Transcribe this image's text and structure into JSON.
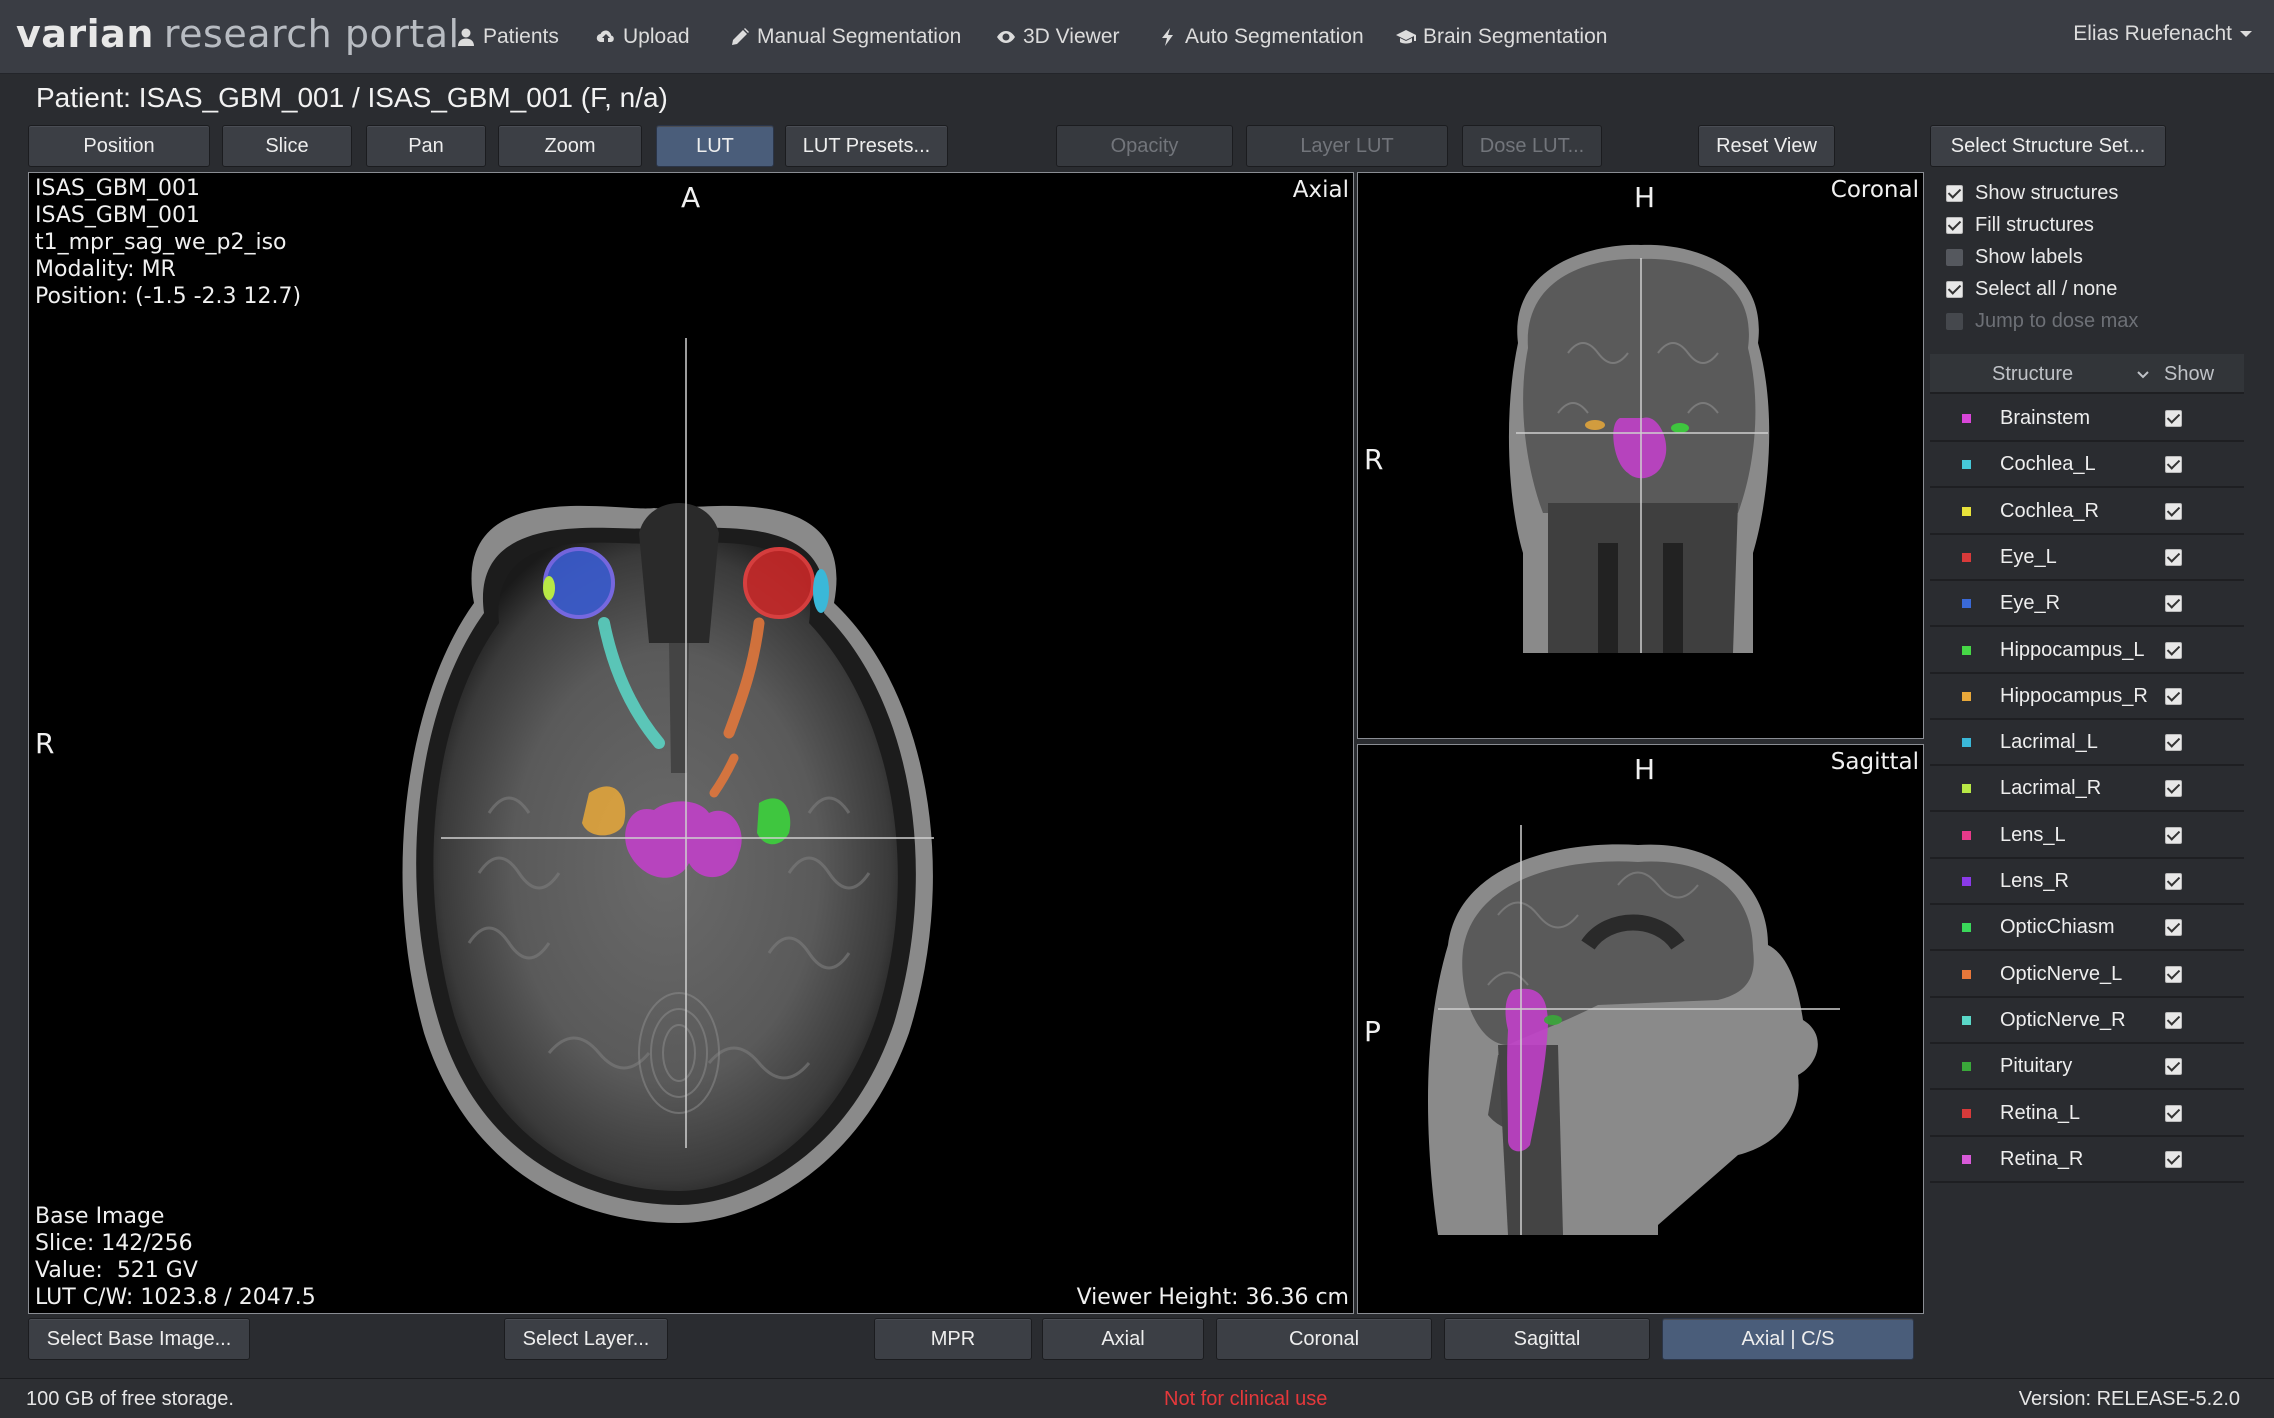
{
  "app": {
    "brand_part1": "varian",
    "brand_part2": "research portal"
  },
  "nav": {
    "patients": "Patients",
    "upload": "Upload",
    "manual_segmentation": "Manual Segmentation",
    "viewer_3d": "3D Viewer",
    "auto_segmentation": "Auto Segmentation",
    "brain_segmentation": "Brain Segmentation",
    "user": "Elias Ruefenacht"
  },
  "patient_title": "Patient: ISAS_GBM_001 / ISAS_GBM_001 (F, n/a)",
  "toolbar": {
    "position": "Position",
    "slice": "Slice",
    "pan": "Pan",
    "zoom": "Zoom",
    "lut": "LUT",
    "lut_presets": "LUT Presets...",
    "opacity": "Opacity",
    "layer_lut": "Layer LUT",
    "dose_lut": "Dose LUT...",
    "reset_view": "Reset View",
    "select_structure_set": "Select Structure Set..."
  },
  "axial_view": {
    "title": "Axial",
    "info_top": "ISAS_GBM_001\nISAS_GBM_001\nt1_mpr_sag_we_p2_iso\nModality: MR\nPosition: (-1.5 -2.3 12.7)",
    "info_bottom": "Base Image\nSlice: 142/256\nValue:  521 GV\nLUT C/W: 1023.8 / 2047.5",
    "viewer_height": "Viewer Height: 36.36 cm",
    "orient_top": "A",
    "orient_left": "R"
  },
  "coronal_view": {
    "title": "Coronal",
    "orient_top": "H",
    "orient_left": "R"
  },
  "sagittal_view": {
    "title": "Sagittal",
    "orient_top": "H",
    "orient_left": "P"
  },
  "bottom_bar": {
    "select_base_image": "Select Base Image...",
    "select_layer": "Select Layer...",
    "mpr": "MPR",
    "axial": "Axial",
    "coronal": "Coronal",
    "sagittal": "Sagittal",
    "axial_cs": "Axial | C/S"
  },
  "options": {
    "show_structures": "Show structures",
    "fill_structures": "Fill structures",
    "show_labels": "Show labels",
    "select_all_none": "Select all / none",
    "jump_to_dose_max": "Jump to dose max"
  },
  "structure_table": {
    "col_structure": "Structure",
    "col_show": "Show",
    "rows": [
      {
        "name": "Brainstem",
        "color": "#d846d8"
      },
      {
        "name": "Cochlea_L",
        "color": "#46c8d8"
      },
      {
        "name": "Cochlea_R",
        "color": "#e8e23a"
      },
      {
        "name": "Eye_L",
        "color": "#d83a3a"
      },
      {
        "name": "Eye_R",
        "color": "#3a6ad8"
      },
      {
        "name": "Hippocampus_L",
        "color": "#46d846"
      },
      {
        "name": "Hippocampus_R",
        "color": "#e8a83a"
      },
      {
        "name": "Lacrimal_L",
        "color": "#3ab8d8"
      },
      {
        "name": "Lacrimal_R",
        "color": "#b8e846"
      },
      {
        "name": "Lens_L",
        "color": "#e83a8a"
      },
      {
        "name": "Lens_R",
        "color": "#8a3ae8"
      },
      {
        "name": "OpticChiasm",
        "color": "#3ad85a"
      },
      {
        "name": "OpticNerve_L",
        "color": "#e8783a"
      },
      {
        "name": "OpticNerve_R",
        "color": "#5ad8c8"
      },
      {
        "name": "Pituitary",
        "color": "#3aa83a"
      },
      {
        "name": "Retina_L",
        "color": "#d83a3a"
      },
      {
        "name": "Retina_R",
        "color": "#d85ad8"
      }
    ]
  },
  "status": {
    "storage": "100 GB of free storage.",
    "warning": "Not for clinical use",
    "version": "Version: RELEASE-5.2.0"
  }
}
